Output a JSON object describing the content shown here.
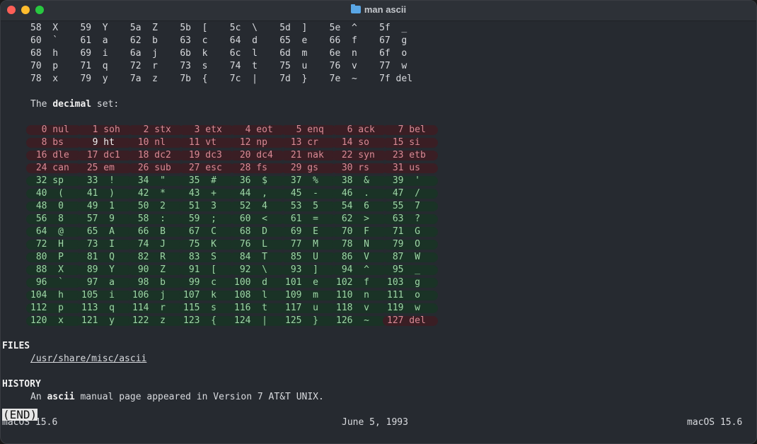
{
  "window": {
    "title": "man ascii",
    "title_icon": "folder-icon"
  },
  "hex_tail_rows": [
    "58  X    59  Y    5a  Z    5b  [    5c  \\    5d  ]    5e  ^    5f  _",
    "60  `    61  a    62  b    63  c    64  d    65  e    66  f    67  g",
    "68  h    69  i    6a  j    6b  k    6c  l    6d  m    6e  n    6f  o",
    "70  p    71  q    72  r    73  s    74  t    75  u    76  v    77  w",
    "78  x    79  y    7a  z    7b  {    7c  |    7d  }    7e  ~    7f del"
  ],
  "decimal_intro": {
    "prefix": "The ",
    "bold": "decimal",
    "suffix": " set:"
  },
  "decimal_table": [
    [
      "  0 nul",
      "  1 soh",
      "  2 stx",
      "  3 etx",
      "  4 eot",
      "  5 enq",
      "  6 ack",
      "  7 bel"
    ],
    [
      "  8 bs ",
      "  9 ht ",
      " 10 nl ",
      " 11 vt ",
      " 12 np ",
      " 13 cr ",
      " 14 so ",
      " 15 si "
    ],
    [
      " 16 dle",
      " 17 dc1",
      " 18 dc2",
      " 19 dc3",
      " 20 dc4",
      " 21 nak",
      " 22 syn",
      " 23 etb"
    ],
    [
      " 24 can",
      " 25 em ",
      " 26 sub",
      " 27 esc",
      " 28 fs ",
      " 29 gs ",
      " 30 rs ",
      " 31 us "
    ],
    [
      " 32 sp ",
      " 33  ! ",
      " 34  \" ",
      " 35  # ",
      " 36  $ ",
      " 37  % ",
      " 38  & ",
      " 39  ' "
    ],
    [
      " 40  ( ",
      " 41  ) ",
      " 42  * ",
      " 43  + ",
      " 44  , ",
      " 45  - ",
      " 46  . ",
      " 47  / "
    ],
    [
      " 48  0 ",
      " 49  1 ",
      " 50  2 ",
      " 51  3 ",
      " 52  4 ",
      " 53  5 ",
      " 54  6 ",
      " 55  7 "
    ],
    [
      " 56  8 ",
      " 57  9 ",
      " 58  : ",
      " 59  ; ",
      " 60  < ",
      " 61  = ",
      " 62  > ",
      " 63  ? "
    ],
    [
      " 64  @ ",
      " 65  A ",
      " 66  B ",
      " 67  C ",
      " 68  D ",
      " 69  E ",
      " 70  F ",
      " 71  G "
    ],
    [
      " 72  H ",
      " 73  I ",
      " 74  J ",
      " 75  K ",
      " 76  L ",
      " 77  M ",
      " 78  N ",
      " 79  O "
    ],
    [
      " 80  P ",
      " 81  Q ",
      " 82  R ",
      " 83  S ",
      " 84  T ",
      " 85  U ",
      " 86  V ",
      " 87  W "
    ],
    [
      " 88  X ",
      " 89  Y ",
      " 90  Z ",
      " 91  [ ",
      " 92  \\ ",
      " 93  ] ",
      " 94  ^ ",
      " 95  _ "
    ],
    [
      " 96  ` ",
      " 97  a ",
      " 98  b ",
      " 99  c ",
      "100  d ",
      "101  e ",
      "102  f ",
      "103  g "
    ],
    [
      "104  h ",
      "105  i ",
      "106  j ",
      "107  k ",
      "108  l ",
      "109  m ",
      "110  n ",
      "111  o "
    ],
    [
      "112  p ",
      "113  q ",
      "114  r ",
      "115  s ",
      "116  t ",
      "117  u ",
      "118  v ",
      "119  w "
    ],
    [
      "120  x ",
      "121  y ",
      "122  z ",
      "123  { ",
      "124  | ",
      "125  } ",
      "126  ~ ",
      "127 del"
    ]
  ],
  "highlighted_cell": "  9 ht ",
  "files": {
    "heading": "FILES",
    "path": "/usr/share/misc/ascii"
  },
  "history": {
    "heading": "HISTORY",
    "prefix": "An ",
    "bold": "ascii",
    "suffix": " manual page appeared in Version 7 AT&T UNIX."
  },
  "footer": {
    "left": "macOS 15.6",
    "center": "June 5, 1993",
    "right": "macOS 15.6"
  },
  "pager_status": "(END)",
  "colors": {
    "control_text": "#d98a95",
    "control_bg": "#3a1e24",
    "printable_text": "#9ed6a6",
    "printable_bg": "#1a3326",
    "background": "#262a30"
  }
}
